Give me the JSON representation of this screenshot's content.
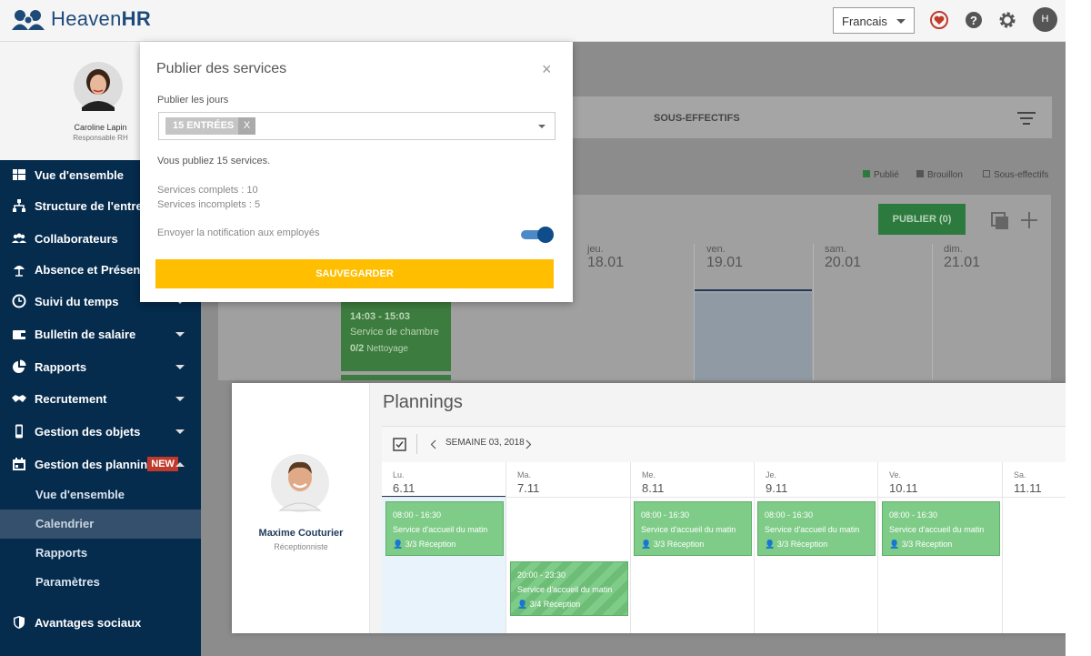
{
  "header": {
    "logo_light": "Heaven",
    "logo_bold": "HR",
    "language": "Francais",
    "avatar_initial": "H",
    "icons": [
      "heart-icon",
      "help-icon",
      "gear-icon"
    ]
  },
  "profile": {
    "name": "Caroline Lapin",
    "role": "Responsable RH"
  },
  "sidebar": {
    "items": [
      {
        "label": "Vue d'ensemble",
        "icon": "overview-icon"
      },
      {
        "label": "Structure de l'entrep",
        "icon": "org-structure-icon"
      },
      {
        "label": "Collaborateurs",
        "icon": "users-icon"
      },
      {
        "label": "Absence et Présence",
        "icon": "beach-umbrella-icon"
      },
      {
        "label": "Suivi du temps",
        "icon": "clock-icon"
      },
      {
        "label": "Bulletin de salaire",
        "icon": "wallet-icon"
      },
      {
        "label": "Rapports",
        "icon": "pie-chart-icon"
      },
      {
        "label": "Recrutement",
        "icon": "handshake-icon"
      },
      {
        "label": "Gestion des objets",
        "icon": "phone-icon"
      },
      {
        "label": "Gestion des plannin",
        "icon": "calendar-icon",
        "badge": "NEW"
      }
    ],
    "subitems": [
      "Vue d'ensemble",
      "Calendrier",
      "Rapports",
      "Paramètres"
    ],
    "last_item": "Avantages sociaux"
  },
  "background": {
    "sous_effectifs": "SOUS-EFFECTIFS",
    "legend": [
      "Publié",
      "Brouillon",
      "Sous-effectifs"
    ],
    "publish_button": "PUBLIER (0)",
    "days": [
      {
        "label": "jeu.",
        "num": "18.01"
      },
      {
        "label": "ven.",
        "num": "19.01"
      },
      {
        "label": "sam.",
        "num": "20.01"
      },
      {
        "label": "dim.",
        "num": "21.01"
      }
    ],
    "card": {
      "time": "14:03 - 15:03",
      "service": "Service de chambre",
      "count": "0/2",
      "dept": "Nettoyage"
    }
  },
  "modal": {
    "title": "Publier des services",
    "days_label": "Publier les jours",
    "tag": "15 ENTRÉES",
    "tag_remove": "X",
    "summary": "Vous publiez 15 services.",
    "complete": "Services complets : 10",
    "incomplete": "Services incomplets : 5",
    "notify": "Envoyer la notification aux employés",
    "notify_on": true,
    "save": "SAUVEGARDER"
  },
  "plannings": {
    "title": "Plannings",
    "week": "SEMAINE 03, 2018",
    "employee": {
      "name": "Maxime Couturier",
      "role": "Réceptionniste"
    },
    "days": [
      {
        "label": "Lu.",
        "num": "6.11"
      },
      {
        "label": "Ma.",
        "num": "7.11"
      },
      {
        "label": "Me.",
        "num": "8.11"
      },
      {
        "label": "Je.",
        "num": "9.11"
      },
      {
        "label": "Ve.",
        "num": "10.11"
      },
      {
        "label": "Sa.",
        "num": "11.11"
      }
    ],
    "shifts": [
      {
        "time": "08:00 - 16:30",
        "service": "Service d'accueil du matin",
        "count": "3/3 Réception"
      },
      {
        "time": "20:00 - 23:30",
        "service": "Service d'accueil du matin",
        "count": "3/4 Réception"
      },
      {
        "time": "08:00 - 16:30",
        "service": "Service d'accueil du matin",
        "count": "3/3 Réception"
      },
      {
        "time": "08:00 - 16:30",
        "service": "Service d'accueil du matin",
        "count": "3/3 Réception"
      },
      {
        "time": "08:00 - 16:30",
        "service": "Service d'accueil du matin",
        "count": "3/3 Réception"
      }
    ]
  }
}
